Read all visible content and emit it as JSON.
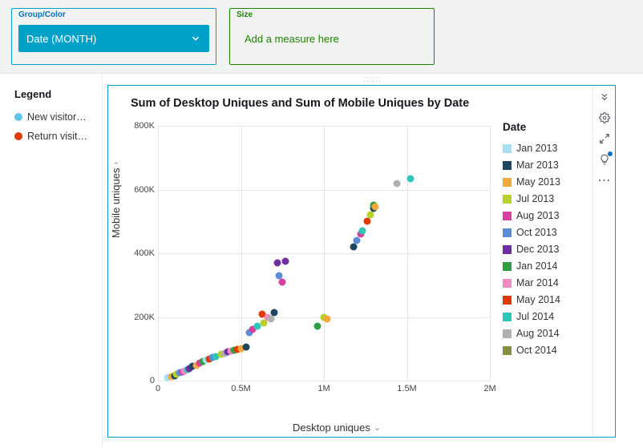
{
  "wells": {
    "group": {
      "label": "Group/Color",
      "value": "Date (MONTH)"
    },
    "size": {
      "label": "Size",
      "placeholder": "Add a measure here"
    }
  },
  "left_legend": {
    "title": "Legend",
    "items": [
      {
        "label": "New visitor…",
        "color": "#61c4e8"
      },
      {
        "label": "Return visit…",
        "color": "#de3b00"
      }
    ]
  },
  "chart": {
    "title": "Sum of Desktop Uniques and Sum of Mobile Uniques by Date",
    "xlabel": "Desktop uniques",
    "ylabel": "Mobile uniques"
  },
  "date_legend": {
    "title": "Date",
    "items": [
      {
        "label": "Jan 2013",
        "color": "#a7dff2"
      },
      {
        "label": "Mar 2013",
        "color": "#1f4560"
      },
      {
        "label": "May 2013",
        "color": "#f2a93c"
      },
      {
        "label": "Jul 2013",
        "color": "#b7d12a"
      },
      {
        "label": "Aug 2013",
        "color": "#d6409f"
      },
      {
        "label": "Oct 2013",
        "color": "#5b8dd6"
      },
      {
        "label": "Dec 2013",
        "color": "#7030a0"
      },
      {
        "label": "Jan 2014",
        "color": "#2e9e44"
      },
      {
        "label": "Mar 2014",
        "color": "#f28cc0"
      },
      {
        "label": "May 2014",
        "color": "#de3b00"
      },
      {
        "label": "Jul 2014",
        "color": "#2dc6b8"
      },
      {
        "label": "Aug 2014",
        "color": "#b0b0b0"
      },
      {
        "label": "Oct 2014",
        "color": "#8a8f3f"
      }
    ]
  },
  "toolbar_icons": [
    "expand-down-icon",
    "gear-icon",
    "maximize-icon",
    "lightbulb-icon",
    "more-icon"
  ],
  "chart_data": {
    "type": "scatter",
    "xlabel": "Desktop uniques",
    "ylabel": "Mobile uniques",
    "xlim": [
      0,
      2000000
    ],
    "ylim": [
      0,
      800000
    ],
    "x_ticks": [
      0,
      500000,
      1000000,
      1500000,
      2000000
    ],
    "x_tick_labels": [
      "0",
      "0.5M",
      "1M",
      "1.5M",
      "2M"
    ],
    "y_ticks": [
      0,
      200000,
      400000,
      600000,
      800000
    ],
    "y_tick_labels": [
      "0",
      "200K",
      "400K",
      "600K",
      "800K"
    ],
    "points": [
      {
        "x": 60000,
        "y": 10000,
        "color": "#a7dff2"
      },
      {
        "x": 80000,
        "y": 12000,
        "color": "#f2a93c"
      },
      {
        "x": 100000,
        "y": 15000,
        "color": "#1f4560"
      },
      {
        "x": 110000,
        "y": 20000,
        "color": "#b7d12a"
      },
      {
        "x": 130000,
        "y": 25000,
        "color": "#5b8dd6"
      },
      {
        "x": 150000,
        "y": 28000,
        "color": "#d6409f"
      },
      {
        "x": 160000,
        "y": 30000,
        "color": "#f28cc0"
      },
      {
        "x": 180000,
        "y": 35000,
        "color": "#2dc6b8"
      },
      {
        "x": 190000,
        "y": 38000,
        "color": "#7030a0"
      },
      {
        "x": 210000,
        "y": 45000,
        "color": "#1f4560"
      },
      {
        "x": 230000,
        "y": 48000,
        "color": "#f2a93c"
      },
      {
        "x": 250000,
        "y": 55000,
        "color": "#d6409f"
      },
      {
        "x": 270000,
        "y": 60000,
        "color": "#2e9e44"
      },
      {
        "x": 290000,
        "y": 65000,
        "color": "#a7dff2"
      },
      {
        "x": 310000,
        "y": 68000,
        "color": "#de3b00"
      },
      {
        "x": 330000,
        "y": 72000,
        "color": "#5b8dd6"
      },
      {
        "x": 350000,
        "y": 76000,
        "color": "#2dc6b8"
      },
      {
        "x": 380000,
        "y": 82000,
        "color": "#b7d12a"
      },
      {
        "x": 400000,
        "y": 85000,
        "color": "#b0b0b0"
      },
      {
        "x": 420000,
        "y": 90000,
        "color": "#7030a0"
      },
      {
        "x": 440000,
        "y": 92000,
        "color": "#f28cc0"
      },
      {
        "x": 460000,
        "y": 95000,
        "color": "#2e9e44"
      },
      {
        "x": 480000,
        "y": 98000,
        "color": "#de3b00"
      },
      {
        "x": 500000,
        "y": 100000,
        "color": "#f2a93c"
      },
      {
        "x": 530000,
        "y": 105000,
        "color": "#1f4560"
      },
      {
        "x": 550000,
        "y": 150000,
        "color": "#5b8dd6"
      },
      {
        "x": 570000,
        "y": 160000,
        "color": "#d6409f"
      },
      {
        "x": 600000,
        "y": 170000,
        "color": "#2dc6b8"
      },
      {
        "x": 630000,
        "y": 210000,
        "color": "#de3b00"
      },
      {
        "x": 640000,
        "y": 180000,
        "color": "#b7d12a"
      },
      {
        "x": 660000,
        "y": 200000,
        "color": "#f28cc0"
      },
      {
        "x": 680000,
        "y": 195000,
        "color": "#b0b0b0"
      },
      {
        "x": 700000,
        "y": 215000,
        "color": "#1f4560"
      },
      {
        "x": 720000,
        "y": 370000,
        "color": "#7030a0"
      },
      {
        "x": 730000,
        "y": 330000,
        "color": "#5b8dd6"
      },
      {
        "x": 750000,
        "y": 310000,
        "color": "#d6409f"
      },
      {
        "x": 770000,
        "y": 375000,
        "color": "#7030a0"
      },
      {
        "x": 960000,
        "y": 170000,
        "color": "#2e9e44"
      },
      {
        "x": 1000000,
        "y": 200000,
        "color": "#b7d12a"
      },
      {
        "x": 1020000,
        "y": 195000,
        "color": "#f2a93c"
      },
      {
        "x": 1180000,
        "y": 420000,
        "color": "#1f4560"
      },
      {
        "x": 1200000,
        "y": 440000,
        "color": "#5b8dd6"
      },
      {
        "x": 1220000,
        "y": 460000,
        "color": "#d6409f"
      },
      {
        "x": 1230000,
        "y": 470000,
        "color": "#2dc6b8"
      },
      {
        "x": 1260000,
        "y": 500000,
        "color": "#de3b00"
      },
      {
        "x": 1280000,
        "y": 520000,
        "color": "#b7d12a"
      },
      {
        "x": 1300000,
        "y": 540000,
        "color": "#1f4560"
      },
      {
        "x": 1300000,
        "y": 550000,
        "color": "#2e9e44"
      },
      {
        "x": 1310000,
        "y": 545000,
        "color": "#f2a93c"
      },
      {
        "x": 1440000,
        "y": 620000,
        "color": "#b0b0b0"
      },
      {
        "x": 1520000,
        "y": 635000,
        "color": "#2dc6b8"
      }
    ]
  }
}
